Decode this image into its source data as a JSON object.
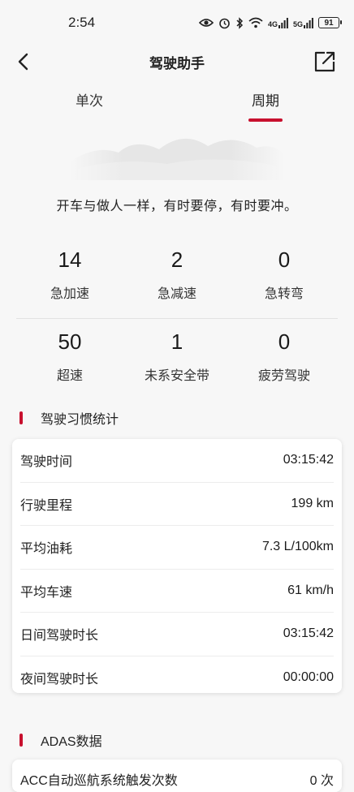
{
  "status_bar": {
    "time": "2:54",
    "battery": "91",
    "net1": "4G",
    "net2": "5G"
  },
  "nav": {
    "title": "驾驶助手"
  },
  "tabs": [
    {
      "label": "单次",
      "active": false
    },
    {
      "label": "周期",
      "active": true
    }
  ],
  "motto": "开车与做人一样，有时要停，有时要冲。",
  "stats": [
    [
      {
        "value": "14",
        "label": "急加速"
      },
      {
        "value": "2",
        "label": "急减速"
      },
      {
        "value": "0",
        "label": "急转弯"
      }
    ],
    [
      {
        "value": "50",
        "label": "超速"
      },
      {
        "value": "1",
        "label": "未系安全带"
      },
      {
        "value": "0",
        "label": "疲劳驾驶"
      }
    ]
  ],
  "habit_section": {
    "title": "驾驶习惯统计",
    "rows": [
      {
        "label": "驾驶时间",
        "value": "03:15:42"
      },
      {
        "label": "行驶里程",
        "value": "199 km"
      },
      {
        "label": "平均油耗",
        "value": "7.3 L/100km"
      },
      {
        "label": "平均车速",
        "value": "61 km/h"
      },
      {
        "label": "日间驾驶时长",
        "value": "03:15:42"
      },
      {
        "label": "夜间驾驶时长",
        "value": "00:00:00"
      }
    ]
  },
  "adas_section": {
    "title": "ADAS数据",
    "rows": [
      {
        "label": "ACC自动巡航系统触发次数",
        "value": "0 次"
      }
    ]
  },
  "colors": {
    "accent": "#c8102e",
    "background": "#f7f7f7"
  }
}
